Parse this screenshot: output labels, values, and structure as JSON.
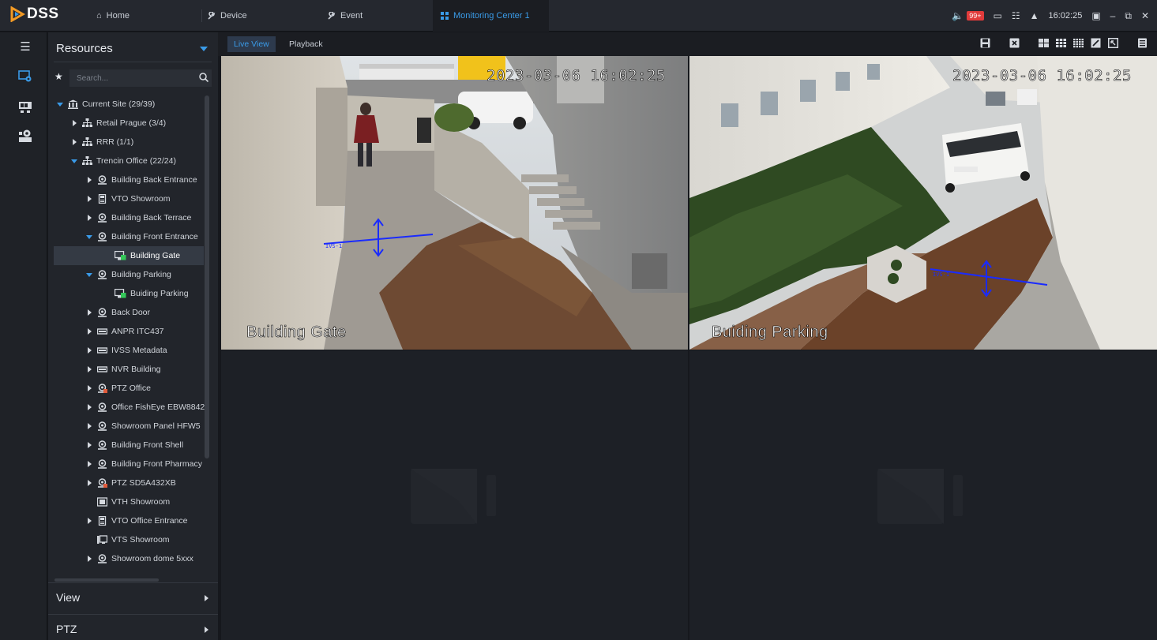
{
  "app": {
    "logo": "DSS",
    "tabs": [
      {
        "label": "Home"
      },
      {
        "label": "Device"
      },
      {
        "label": "Event"
      },
      {
        "label": "Monitoring Center 1"
      }
    ],
    "alarm_badge": "99+",
    "clock": "16:02:25"
  },
  "panel": {
    "title": "Resources",
    "search_placeholder": "Search...",
    "tree": [
      {
        "label": "Current Site (29/39)"
      },
      {
        "label": "Retail Prague (3/4)"
      },
      {
        "label": "RRR (1/1)"
      },
      {
        "label": "Trencin Office (22/24)"
      },
      {
        "label": "Building Back Entrance"
      },
      {
        "label": "VTO Showroom"
      },
      {
        "label": "Building Back Terrace"
      },
      {
        "label": "Building  Front Entrance"
      },
      {
        "label": "Building Gate"
      },
      {
        "label": "Building  Parking"
      },
      {
        "label": "Buiding Parking"
      },
      {
        "label": "Back Door"
      },
      {
        "label": "ANPR ITC437"
      },
      {
        "label": "IVSS Metadata"
      },
      {
        "label": "NVR Building"
      },
      {
        "label": "PTZ Office"
      },
      {
        "label": "Office FishEye EBW8842"
      },
      {
        "label": "Showroom Panel HFW5"
      },
      {
        "label": "Building  Front Shell"
      },
      {
        "label": "Building Front Pharmacy"
      },
      {
        "label": "PTZ SD5A432XB"
      },
      {
        "label": "VTH Showroom"
      },
      {
        "label": "VTO Office Entrance"
      },
      {
        "label": "VTS Showroom"
      },
      {
        "label": "Showroom dome 5xxx"
      }
    ],
    "sections": [
      {
        "label": "View"
      },
      {
        "label": "PTZ"
      }
    ]
  },
  "viewbar": {
    "live_label": "Live View",
    "playback_label": "Playback"
  },
  "videos": [
    {
      "timestamp": "2023-03-06 16:02:25",
      "label": "Building Gate",
      "ivs_tag": "IVS-1"
    },
    {
      "timestamp": "2023-03-06 16:02:25",
      "label": "Buiding Parking",
      "ivs_tag": "IVS-1"
    }
  ],
  "colors": {
    "accent": "#3a9be8",
    "badge": "#e03b3b",
    "ivs_line": "#1a2bff"
  }
}
